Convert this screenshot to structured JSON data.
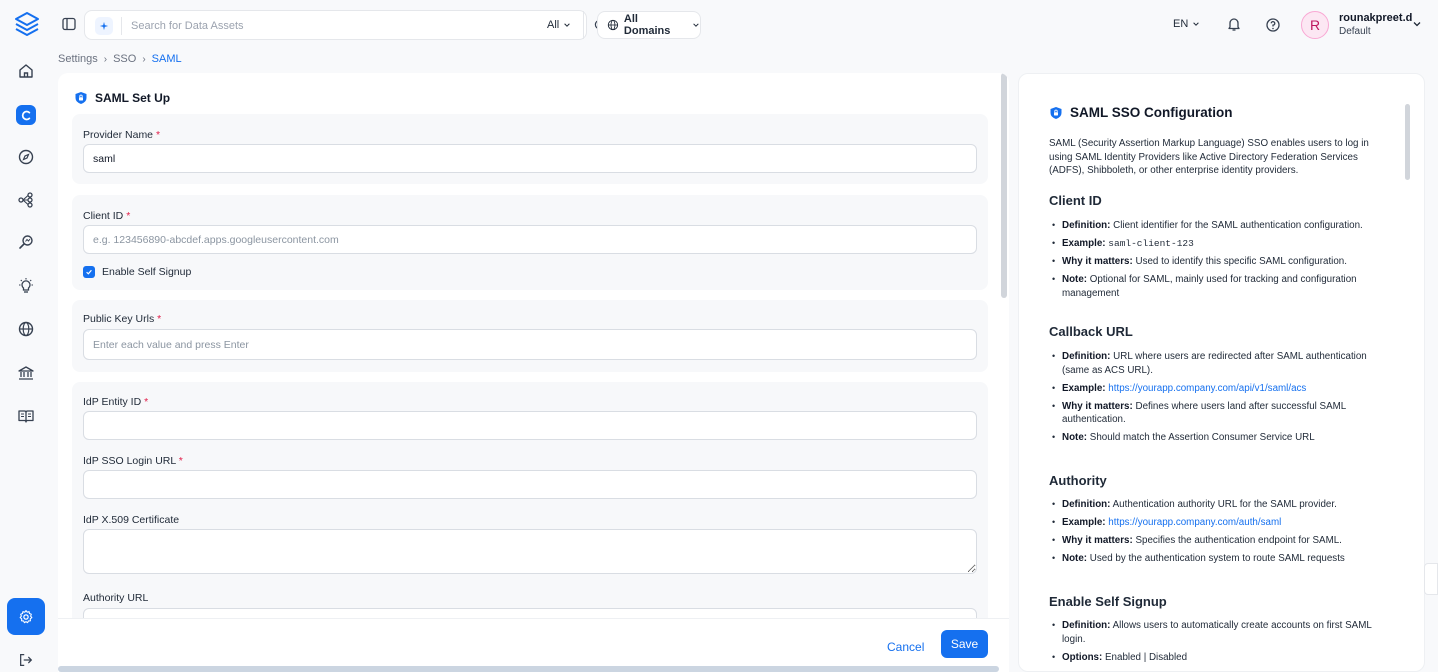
{
  "search": {
    "placeholder": "Search for Data Assets",
    "scope": "All"
  },
  "domains": {
    "label": "All Domains"
  },
  "header": {
    "language": "EN",
    "user_name": "rounakpreet.d",
    "user_role": "Default",
    "avatar_initial": "R"
  },
  "breadcrumb": [
    "Settings",
    "SSO",
    "SAML"
  ],
  "form": {
    "title": "SAML Set Up",
    "provider_name": {
      "label": "Provider Name",
      "value": "saml"
    },
    "client_id": {
      "label": "Client ID",
      "placeholder": "e.g. 123456890-abcdef.apps.googleusercontent.com"
    },
    "self_signup": {
      "label": "Enable Self Signup",
      "checked": true
    },
    "public_key_urls": {
      "label": "Public Key Urls",
      "placeholder": "Enter each value and press Enter"
    },
    "idp_entity_id": {
      "label": "IdP Entity ID"
    },
    "idp_sso_login_url": {
      "label": "IdP SSO Login URL"
    },
    "idp_certificate": {
      "label": "IdP X.509 Certificate"
    },
    "authority_url": {
      "label": "Authority URL"
    },
    "required_marker": "*",
    "cancel_label": "Cancel",
    "save_label": "Save"
  },
  "docs": {
    "title": "SAML SSO Configuration",
    "intro": "SAML (Security Assertion Markup Language) SSO enables users to log in using SAML Identity Providers like Active Directory Federation Services (ADFS), Shibboleth, or other enterprise identity providers.",
    "labels": {
      "definition": "Definition:",
      "example": "Example:",
      "why": "Why it matters:",
      "note": "Note:",
      "options": "Options:"
    },
    "client_id": {
      "heading": "Client ID",
      "definition": "Client identifier for the SAML authentication configuration.",
      "example": "saml-client-123",
      "why": "Used to identify this specific SAML configuration.",
      "note": "Optional for SAML, mainly used for tracking and configuration management"
    },
    "callback_url": {
      "heading": "Callback URL",
      "definition": "URL where users are redirected after SAML authentication (same as ACS URL).",
      "example": "https://yourapp.company.com/api/v1/saml/acs",
      "why": "Defines where users land after successful SAML authentication.",
      "note": "Should match the Assertion Consumer Service URL"
    },
    "authority": {
      "heading": "Authority",
      "definition": "Authentication authority URL for the SAML provider.",
      "example": "https://yourapp.company.com/auth/saml",
      "why": "Specifies the authentication endpoint for SAML.",
      "note": "Used by the authentication system to route SAML requests"
    },
    "self_signup": {
      "heading": "Enable Self Signup",
      "definition": "Allows users to automatically create accounts on first SAML login.",
      "options": "Enabled | Disabled"
    }
  }
}
